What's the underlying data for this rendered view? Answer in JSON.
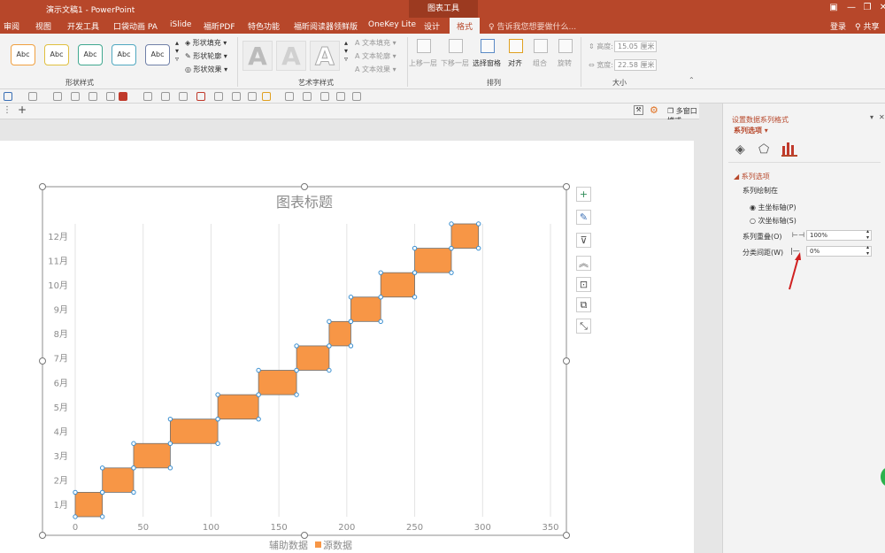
{
  "window": {
    "doc_title": "演示文稿1 - PowerPoint",
    "context_tab_group": "图表工具",
    "win_controls": [
      "▣",
      "—",
      "❐",
      "✕"
    ]
  },
  "menu": {
    "tabs": [
      "审阅",
      "视图",
      "开发工具",
      "口袋动画 PA",
      "iSlide",
      "福昕PDF",
      "特色功能",
      "福昕阅读器领鲜版",
      "OneKey Lite",
      "设计",
      "格式"
    ],
    "active_tab": "格式",
    "tell_me": "告诉我您想要做什么...",
    "login": "登录",
    "share": "共享"
  },
  "ribbon": {
    "shape_styles": {
      "label": "形状样式",
      "swatch_text": "Abc",
      "swatch_colors": [
        "#f0a040",
        "#e0c040",
        "#40a890",
        "#50a8c0",
        "#7080a8"
      ],
      "fill": "形状填充",
      "outline": "形状轮廓",
      "effect": "形状效果"
    },
    "art_styles": {
      "label": "艺术字样式",
      "letter": "A",
      "text_fill": "文本填充",
      "text_outline": "文本轮廓",
      "text_effect": "文本效果"
    },
    "arrange": {
      "label": "排列",
      "bring_forward": "上移一层",
      "send_backward": "下移一层",
      "selection_pane": "选择窗格",
      "align": "对齐",
      "group": "组合",
      "rotate": "旋转"
    },
    "size": {
      "label": "大小",
      "height_label": "高度:",
      "height_value": "15.05 厘米",
      "width_label": "宽度:",
      "width_value": "22.58 厘米"
    }
  },
  "view_mode": "多窗口模式",
  "tab_add": "+",
  "chart_data": {
    "type": "bar",
    "orientation": "horizontal",
    "stacked": true,
    "title": "图表标题",
    "categories": [
      "1月",
      "2月",
      "3月",
      "4月",
      "5月",
      "6月",
      "7月",
      "8月",
      "9月",
      "10月",
      "11月",
      "12月"
    ],
    "series": [
      {
        "name": "辅助数据",
        "values": [
          0,
          20,
          43,
          70,
          105,
          135,
          163,
          187,
          203,
          225,
          250,
          277
        ],
        "color": "none"
      },
      {
        "name": "源数据",
        "values": [
          20,
          23,
          27,
          35,
          30,
          28,
          24,
          16,
          22,
          25,
          27,
          20
        ],
        "color": "#f79646"
      }
    ],
    "xlim": [
      0,
      350
    ],
    "xticks": [
      0,
      50,
      100,
      150,
      200,
      250,
      300,
      350
    ],
    "grid": true,
    "legend_position": "bottom"
  },
  "chart_tools": [
    "+",
    "✎",
    "⊽",
    "︽",
    "⊡",
    "⧉",
    "⤡"
  ],
  "pane": {
    "title": "设置数据系列格式",
    "subtitle": "系列选项",
    "section": "系列选项",
    "plot_on": "系列绘制在",
    "primary_axis": "主坐标轴(P)",
    "secondary_axis": "次坐标轴(S)",
    "overlap_label": "系列重叠(O)",
    "overlap_value": "100%",
    "gap_label": "分类间距(W)",
    "gap_value": "0%"
  }
}
